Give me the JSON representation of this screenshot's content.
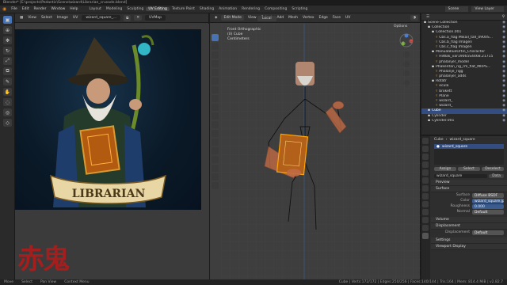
{
  "window": {
    "title": "Blender* [E:\\projects\\Pedantic\\Scene\\wizard\\Librarian_crusade.blend]"
  },
  "menu": [
    "File",
    "Edit",
    "Render",
    "Window",
    "Help"
  ],
  "workspaces": [
    {
      "label": "Layout",
      "active": false
    },
    {
      "label": "Modeling",
      "active": false
    },
    {
      "label": "Sculpting",
      "active": false
    },
    {
      "label": "UV Editing",
      "active": true
    },
    {
      "label": "Texture Paint",
      "active": false
    },
    {
      "label": "Shading",
      "active": false
    },
    {
      "label": "Animation",
      "active": false
    },
    {
      "label": "Rendering",
      "active": false
    },
    {
      "label": "Compositing",
      "active": false
    },
    {
      "label": "Scripting",
      "active": false
    }
  ],
  "top_right": {
    "scene": "Scene",
    "view_layer": "View Layer"
  },
  "image_editor": {
    "header": [
      "View",
      "Select",
      "Image",
      "UV"
    ],
    "image_name": "wizard_square_...",
    "uvmap": "UVMap",
    "artwork": {
      "banner_text": "LIBRARIAN"
    }
  },
  "viewport": {
    "mode": "Edit Mode",
    "menus": [
      "View",
      "Select",
      "Add",
      "Mesh",
      "Vertex",
      "Edge",
      "Face",
      "UV"
    ],
    "orientation": "Local",
    "options_label": "Options",
    "info": [
      "Front Orthographic",
      "(0) Cube",
      "Centimeters"
    ]
  },
  "outliner": {
    "title": "Scene Collection",
    "rows": [
      {
        "label": "Scene Collection",
        "indent": 0,
        "sel": false
      },
      {
        "label": "Collection",
        "indent": 1,
        "sel": false
      },
      {
        "label": "Collection.001",
        "indent": 2,
        "sel": false
      },
      {
        "label": "Cbs.a_flag Mikail_tall_0900S...",
        "indent": 3,
        "sel": false
      },
      {
        "label": "Cbs.b_flag Imagen",
        "indent": 3,
        "sel": false
      },
      {
        "label": "Cbs.c_flag Imagen",
        "indent": 3,
        "sel": false
      },
      {
        "label": "ManualBlueOrtin_Character",
        "indent": 2,
        "sel": false
      },
      {
        "label": "HiWak_var19065S4468.21715",
        "indent": 3,
        "sel": false
      },
      {
        "label": "phalanjer_model",
        "indent": 3,
        "sel": false
      },
      {
        "label": "Phakentan_rig_rm_flat_MRPS...",
        "indent": 2,
        "sel": false
      },
      {
        "label": "Phalanje_rigg",
        "indent": 3,
        "sel": false
      },
      {
        "label": "phalanjer_adds",
        "indent": 3,
        "sel": false
      },
      {
        "label": "Rotatr",
        "indent": 2,
        "sel": false
      },
      {
        "label": "ocula",
        "indent": 3,
        "sel": false
      },
      {
        "label": "brokett",
        "indent": 3,
        "sel": false
      },
      {
        "label": "Plane",
        "indent": 3,
        "sel": false
      },
      {
        "label": "wizard_",
        "indent": 3,
        "sel": false
      },
      {
        "label": "wizard_",
        "indent": 3,
        "sel": false
      },
      {
        "label": "Cube",
        "indent": 1,
        "sel": true
      },
      {
        "label": "Cylinder",
        "indent": 1,
        "sel": false
      },
      {
        "label": "Cylinder.001",
        "indent": 1,
        "sel": false
      }
    ]
  },
  "properties": {
    "object": "Cube",
    "material": "wizard_square",
    "slot": "wizard_square",
    "slot_buttons": [
      "Assign",
      "Select",
      "Deselect"
    ],
    "data_label": "Data",
    "sections": {
      "preview": "Preview",
      "surface": "Surface",
      "volume": "Volume",
      "displacement": "Displacement",
      "settings": "Settings",
      "viewport_display": "Viewport Display"
    },
    "surface": {
      "surface_label": "Surface",
      "surface_val": "Diffuse BSDF",
      "color_label": "Color",
      "color_val": "wizard_square.jpg",
      "roughness_label": "Roughness",
      "roughness_val": "0.000",
      "normal_label": "Normal",
      "normal_val": "Default"
    },
    "displacement": {
      "label": "Displacement",
      "val": "Default"
    }
  },
  "status": {
    "left": [
      "Move",
      "Select",
      "Pan View",
      "Context Menu"
    ],
    "right": "Cube | Verts:172/172 | Edges:250/256 | Faces:140/144 | Tris:164 | Mem: 814.4 MiB | v2.82.7"
  },
  "watermark": "赤鬼"
}
